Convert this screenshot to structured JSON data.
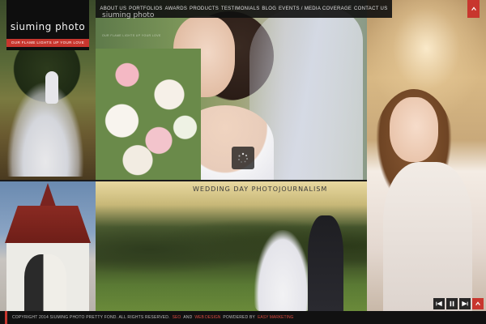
{
  "logo": {
    "text": "siuming photo",
    "tagline": "OUR FLAME LIGHTS UP YOUR LOVE"
  },
  "nav": {
    "items": [
      "ABOUT US",
      "PORTFOLIOS",
      "AWARDS",
      "PRODUCTS",
      "TESTIMONIALS",
      "BLOG",
      "EVENTS / MEDIA COVERAGE",
      "CONTACT US"
    ],
    "ghost_logo": "siuming photo",
    "ghost_tag": "OUR FLAME LIGHTS UP YOUR LOVE"
  },
  "caption": "WEDDING DAY PHOTOJOURNALISM",
  "footer": {
    "copyright": "COPYRIGHT 2014 SIUMING PHOTO PRETTY FOND. ALL RIGHTS RESERVED.",
    "link_seo": "SEO",
    "and": "AND",
    "link_web_design": "WEB DESIGN",
    "powered_by": "POWDERED BY",
    "link_easy": "EASY MARKETING"
  },
  "colors": {
    "accent": "#c8362e",
    "nav_bg": "#101010",
    "footer_bg": "#111111"
  },
  "icons": {
    "corner": "chevron-up-icon",
    "prev": "previous-icon",
    "pause": "pause-icon",
    "next": "next-icon",
    "toggle": "chevron-up-icon",
    "loader": "loading-spinner-icon"
  }
}
